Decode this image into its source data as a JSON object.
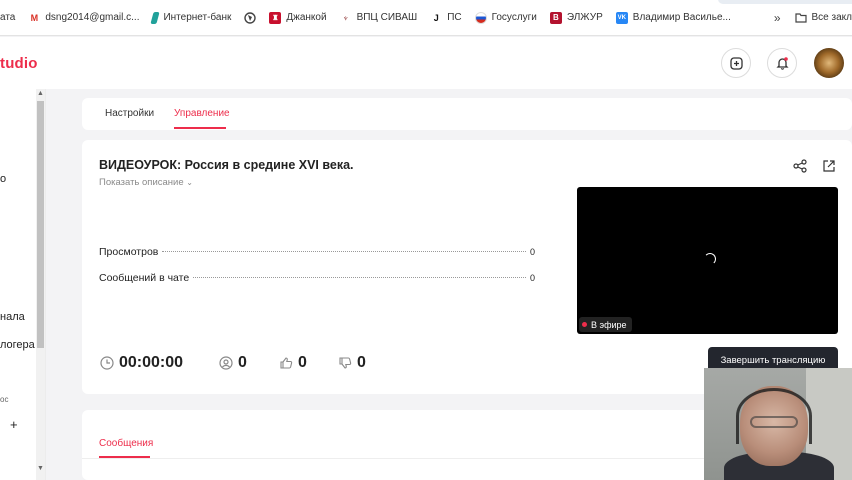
{
  "bookmarks": {
    "items": [
      {
        "label": "ата",
        "icon": "none"
      },
      {
        "label": "dsng2014@gmail.c...",
        "icon": "gmail-icon"
      },
      {
        "label": "Интернет-банк",
        "icon": "bank-icon"
      },
      {
        "label": "",
        "icon": "globe-icon"
      },
      {
        "label": "Джанкой",
        "icon": "crest-icon"
      },
      {
        "label": "ВПЦ СИВАШ",
        "icon": "emblem-icon"
      },
      {
        "label": "ПС",
        "icon": "j-icon"
      },
      {
        "label": "Госуслуги",
        "icon": "russia-flag-icon"
      },
      {
        "label": "ЭЛЖУР",
        "icon": "book-icon"
      },
      {
        "label": "Владимир Василье...",
        "icon": "vk-icon"
      }
    ],
    "more": "»",
    "folder_label": "Все закл"
  },
  "header": {
    "logo": "tudio",
    "add_icon": "plus-square-icon",
    "bell_icon": "bell-icon"
  },
  "sidebar": {
    "items": [
      {
        "label": "о"
      },
      {
        "label": "нала"
      },
      {
        "label": "логера"
      },
      {
        "label": "ос"
      },
      {
        "label": "+"
      }
    ]
  },
  "tabs": {
    "settings": "Настройки",
    "manage": "Управление",
    "active": "manage"
  },
  "video": {
    "title": "ВИДЕОУРОК: Россия в средине XVI века.",
    "show_description": "Показать описание",
    "stats": [
      {
        "label": "Просмотров",
        "value": "0"
      },
      {
        "label": "Сообщений в чате",
        "value": "0"
      }
    ],
    "live_label": "В эфире",
    "duration": "00:00:00",
    "viewers": "0",
    "likes": "0",
    "dislikes": "0"
  },
  "actions": {
    "end_stream": "Завершить трансляцию"
  },
  "messages": {
    "tab": "Сообщения"
  },
  "colors": {
    "accent": "#ed2d4b",
    "player_bg": "#000000",
    "end_button_bg": "#23262e"
  }
}
